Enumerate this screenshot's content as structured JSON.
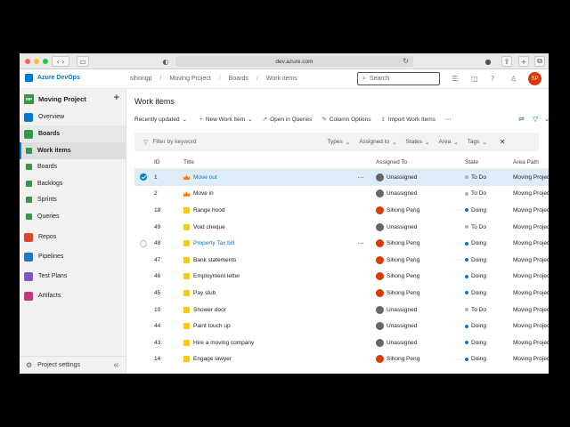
{
  "browser": {
    "url": "dev.azure.com",
    "colors": {
      "close": "#ff5f57",
      "minimize": "#febc2e",
      "maximize": "#28c840"
    }
  },
  "header": {
    "brand": "Azure DevOps",
    "breadcrumbs": [
      "sihongp",
      "Moving Project",
      "Boards",
      "Work items"
    ],
    "search_placeholder": "Search",
    "avatar_initials": "SP"
  },
  "sidebar": {
    "project_name": "Moving Project",
    "project_badge": "MP",
    "items": [
      {
        "label": "Overview",
        "icon": "overview-icon",
        "color": "#0078d4"
      },
      {
        "label": "Boards",
        "icon": "boards-icon",
        "color": "#339947"
      },
      {
        "label": "Work items",
        "icon": "work-items-icon",
        "color": "#339947"
      },
      {
        "label": "Boards",
        "icon": "boards-sub-icon",
        "color": "#339947"
      },
      {
        "label": "Backlogs",
        "icon": "backlogs-icon",
        "color": "#339947"
      },
      {
        "label": "Sprints",
        "icon": "sprints-icon",
        "color": "#339947"
      },
      {
        "label": "Queries",
        "icon": "queries-icon",
        "color": "#339947"
      },
      {
        "label": "Repos",
        "icon": "repos-icon",
        "color": "#e0432d"
      },
      {
        "label": "Pipelines",
        "icon": "pipelines-icon",
        "color": "#1f75cb"
      },
      {
        "label": "Test Plans",
        "icon": "test-plans-icon",
        "color": "#7e57c2"
      },
      {
        "label": "Artifacts",
        "icon": "artifacts-icon",
        "color": "#c2367b"
      }
    ],
    "settings_label": "Project settings"
  },
  "main": {
    "title": "Work items",
    "toolbar": {
      "view": "Recently updated",
      "new_item": "New Work Item",
      "open_queries": "Open in Queries",
      "column_options": "Column Options",
      "import": "Import Work Items"
    },
    "filter": {
      "placeholder": "Filter by keyword",
      "dropdowns": [
        "Types",
        "Assigned to",
        "States",
        "Area",
        "Tags"
      ]
    },
    "columns": {
      "id": "ID",
      "title": "Title",
      "assigned": "Assigned To",
      "state": "State",
      "area": "Area Path"
    },
    "rows": [
      {
        "id": "1",
        "title": "Move out",
        "type": "epic",
        "assigned": "Unassigned",
        "state": "To Do",
        "area": "Moving Project"
      },
      {
        "id": "2",
        "title": "Move in",
        "type": "epic",
        "assigned": "Unassigned",
        "state": "To Do",
        "area": "Moving Project"
      },
      {
        "id": "18",
        "title": "Range hood",
        "type": "task",
        "assigned": "Sihong Peng",
        "state": "Doing",
        "area": "Moving Project"
      },
      {
        "id": "49",
        "title": "Void cheque",
        "type": "task",
        "assigned": "Unassigned",
        "state": "To Do",
        "area": "Moving Project"
      },
      {
        "id": "48",
        "title": "Property Tax bill",
        "type": "task",
        "assigned": "Sihong Peng",
        "state": "Doing",
        "area": "Moving Project"
      },
      {
        "id": "47",
        "title": "Bank statements",
        "type": "task",
        "assigned": "Sihong Peng",
        "state": "Doing",
        "area": "Moving Project"
      },
      {
        "id": "46",
        "title": "Employment letter",
        "type": "task",
        "assigned": "Sihong Peng",
        "state": "Doing",
        "area": "Moving Project"
      },
      {
        "id": "45",
        "title": "Pay stub",
        "type": "task",
        "assigned": "Sihong Peng",
        "state": "Doing",
        "area": "Moving Project"
      },
      {
        "id": "10",
        "title": "Shower door",
        "type": "task",
        "assigned": "Unassigned",
        "state": "To Do",
        "area": "Moving Project"
      },
      {
        "id": "44",
        "title": "Paint touch up",
        "type": "task",
        "assigned": "Unassigned",
        "state": "Doing",
        "area": "Moving Project"
      },
      {
        "id": "43",
        "title": "Hire a moving company",
        "type": "task",
        "assigned": "Unassigned",
        "state": "Doing",
        "area": "Moving Project"
      },
      {
        "id": "14",
        "title": "Engage lawyer",
        "type": "task",
        "assigned": "Sihong Peng",
        "state": "Doing",
        "area": "Moving Project"
      }
    ],
    "state_colors": {
      "To Do": "#b2b2b2",
      "Doing": "#007acc"
    }
  }
}
